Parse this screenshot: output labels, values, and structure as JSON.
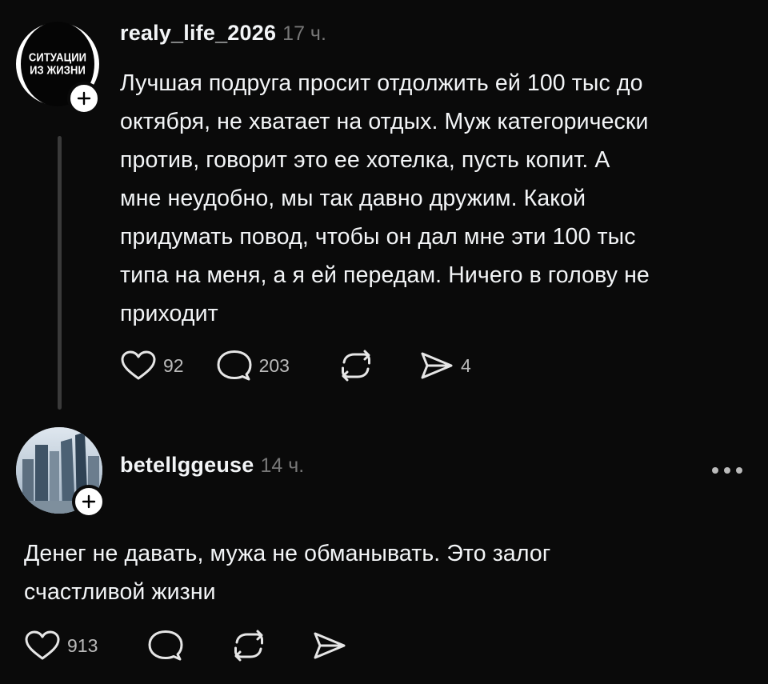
{
  "post1": {
    "avatar_line1": "СИТУАЦИИ",
    "avatar_line2": "ИЗ ЖИЗНИ",
    "username": "realy_life_2026",
    "time": "17 ч.",
    "text_lines": [
      "Лучшая подруга просит отдолжить ей 100 тыс до",
      "октября, не хватает на отдых. Муж категорически",
      "против, говорит это ее хотелка, пусть копит. А",
      "мне неудобно, мы так давно дружим. Какой",
      "придумать повод, чтобы он дал мне эти 100 тыс",
      "типа на меня, а я ей передам. Ничего в голову не",
      "приходит"
    ],
    "likes": "92",
    "comments": "203",
    "shares": "4"
  },
  "post2": {
    "username": "betellggeuse",
    "time": "14 ч.",
    "text_lines": [
      "Денег не давать, мужа не обманывать. Это залог",
      "счастливой жизни"
    ],
    "likes": "913"
  },
  "icons": {
    "like": "heart-icon",
    "comment": "speech-bubble-icon",
    "repost": "repost-icon",
    "share": "send-icon",
    "follow": "plus-icon",
    "more": "more-icon"
  }
}
